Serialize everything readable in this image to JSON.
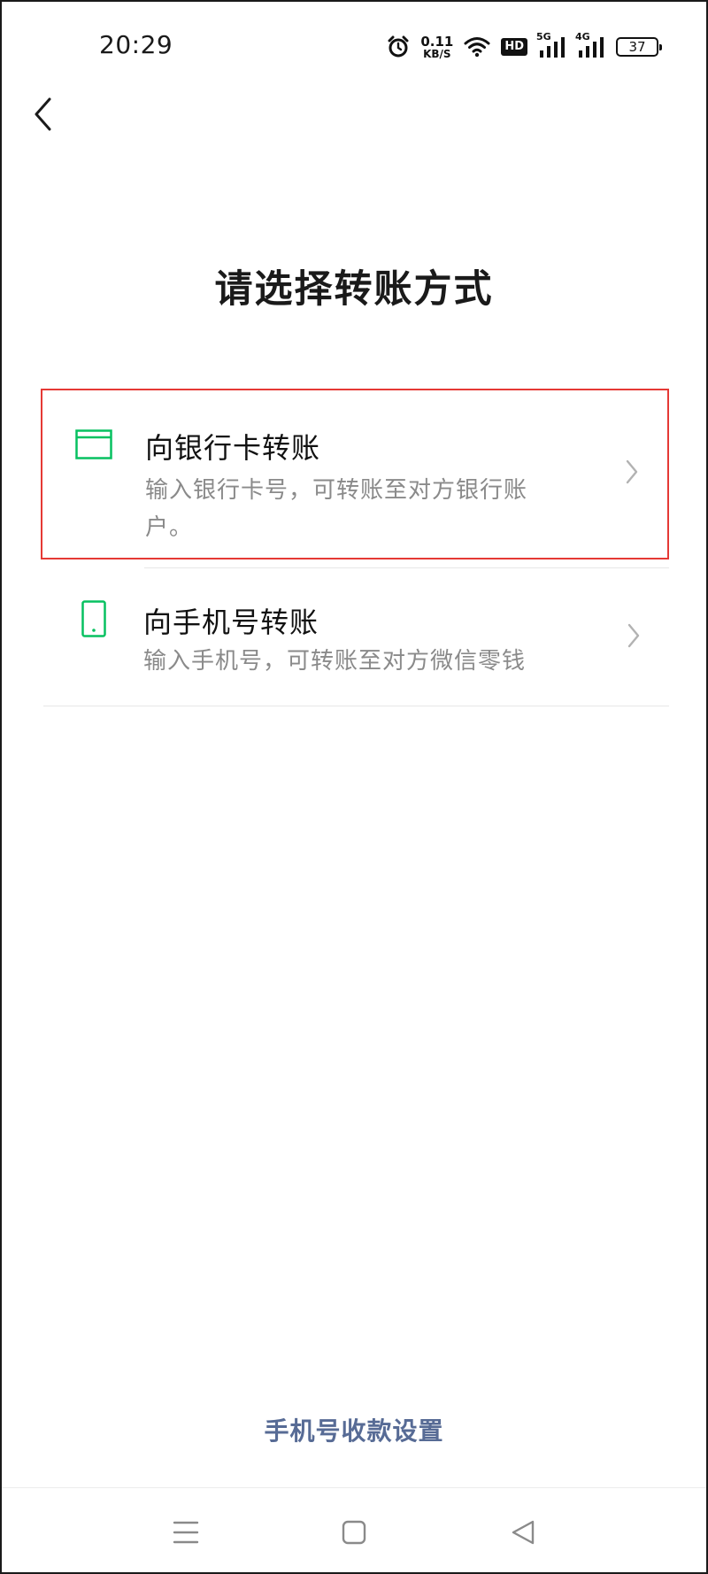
{
  "status_bar": {
    "time": "20:29",
    "net_speed_value": "0.11",
    "net_speed_unit": "KB/S",
    "hd_badge": "HD",
    "signal_1_label": "5G",
    "signal_2_label": "4G",
    "battery_level": "37",
    "icons": [
      "alarm-icon",
      "wifi-icon",
      "hd-icon",
      "signal-icon",
      "battery-icon"
    ]
  },
  "header": {
    "back_icon": "chevron-left-icon"
  },
  "page": {
    "title": "请选择转账方式"
  },
  "options": [
    {
      "icon": "bank-card-icon",
      "title": "向银行卡转账",
      "description": "输入银行卡号，可转账至对方银行账户。",
      "chevron": "chevron-right-icon"
    },
    {
      "icon": "phone-icon",
      "title": "向手机号转账",
      "description": "输入手机号，可转账至对方微信零钱",
      "chevron": "chevron-right-icon"
    }
  ],
  "footer": {
    "link_label": "手机号收款设置"
  },
  "nav_bar": {
    "icons": [
      "menu-icon",
      "home-icon",
      "back-triangle-icon"
    ]
  },
  "colors": {
    "accent_green": "#07c160",
    "link_blue": "#576b95",
    "highlight_red": "#e53935",
    "secondary_text": "#8a8a8a"
  }
}
